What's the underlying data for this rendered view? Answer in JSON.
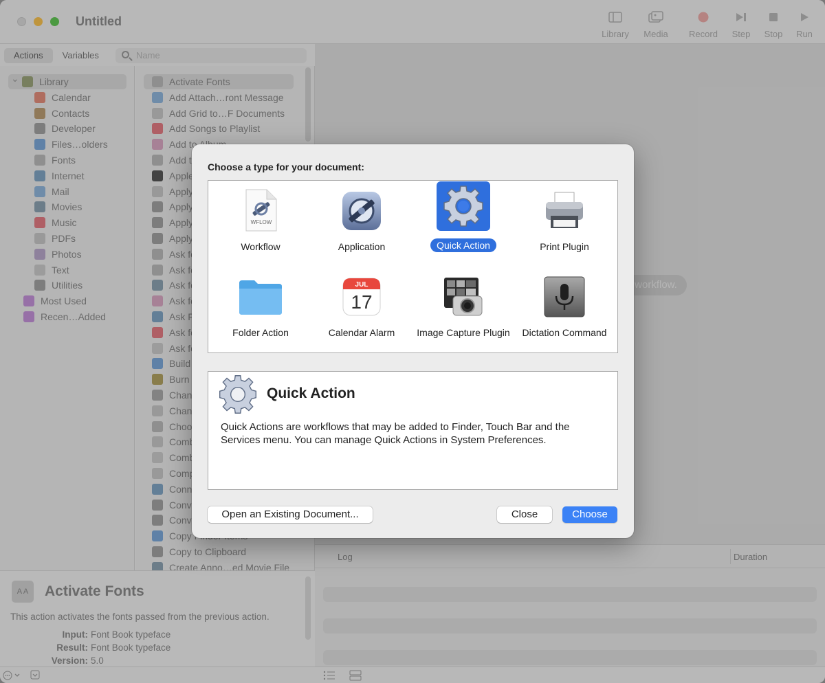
{
  "window": {
    "title": "Untitled"
  },
  "toolbar": {
    "library": "Library",
    "media": "Media",
    "record": "Record",
    "step": "Step",
    "stop": "Stop",
    "run": "Run"
  },
  "sidebar": {
    "tabs": {
      "actions": "Actions",
      "variables": "Variables"
    },
    "search_placeholder": "Name",
    "library": [
      {
        "label": "Library",
        "icon": "library-icon",
        "color": "#9aa37a"
      },
      {
        "label": "Calendar",
        "icon": "calendar-icon",
        "color": "#e08c7a"
      },
      {
        "label": "Contacts",
        "icon": "contacts-icon",
        "color": "#b99b73"
      },
      {
        "label": "Developer",
        "icon": "tools-icon",
        "color": "#a0a0a0"
      },
      {
        "label": "Files…olders",
        "icon": "finder-icon",
        "color": "#7aa6d6"
      },
      {
        "label": "Fonts",
        "icon": "fonts-icon",
        "color": "#b8b8b8"
      },
      {
        "label": "Internet",
        "icon": "globe-icon",
        "color": "#7fa3c2"
      },
      {
        "label": "Mail",
        "icon": "mail-icon",
        "color": "#8fb4d9"
      },
      {
        "label": "Movies",
        "icon": "movies-icon",
        "color": "#8ba0b0"
      },
      {
        "label": "Music",
        "icon": "music-icon",
        "color": "#e07a82"
      },
      {
        "label": "PDFs",
        "icon": "pdf-icon",
        "color": "#c4c4c4"
      },
      {
        "label": "Photos",
        "icon": "photos-icon",
        "color": "#b7a6c8"
      },
      {
        "label": "Text",
        "icon": "text-icon",
        "color": "#c8c8c8"
      },
      {
        "label": "Utilities",
        "icon": "tools-icon",
        "color": "#a0a0a0"
      },
      {
        "label": "Most Used",
        "icon": "smart-folder-icon",
        "color": "#c290d6"
      },
      {
        "label": "Recen…Added",
        "icon": "smart-folder-icon",
        "color": "#c290d6"
      }
    ],
    "actions": [
      {
        "label": "Activate Fonts",
        "color": "#b8b8b8"
      },
      {
        "label": "Add Attach…ront Message",
        "color": "#8fb4d9"
      },
      {
        "label": "Add Grid to…F Documents",
        "color": "#c4c4c4"
      },
      {
        "label": "Add Songs to Playlist",
        "color": "#e07a82"
      },
      {
        "label": "Add to Album",
        "color": "#d6a6c0"
      },
      {
        "label": "Add t",
        "color": "#b8b8b8"
      },
      {
        "label": "Apple",
        "color": "#555555"
      },
      {
        "label": "Apply",
        "color": "#c4c4c4"
      },
      {
        "label": "Apply",
        "color": "#a0a0a0"
      },
      {
        "label": "Apply",
        "color": "#a0a0a0"
      },
      {
        "label": "Apply",
        "color": "#a0a0a0"
      },
      {
        "label": "Ask fo",
        "color": "#b8b8b8"
      },
      {
        "label": "Ask fo",
        "color": "#b8b8b8"
      },
      {
        "label": "Ask fo",
        "color": "#8ba0b0"
      },
      {
        "label": "Ask fo",
        "color": "#d6a6c0"
      },
      {
        "label": "Ask F",
        "color": "#7fa3c2"
      },
      {
        "label": "Ask fo",
        "color": "#e07a82"
      },
      {
        "label": "Ask fo",
        "color": "#c8c8c8"
      },
      {
        "label": "Build",
        "color": "#7aa6d6"
      },
      {
        "label": "Burn",
        "color": "#b0a060"
      },
      {
        "label": "Chan",
        "color": "#a8a8a8"
      },
      {
        "label": "Chan",
        "color": "#c4c4c4"
      },
      {
        "label": "Choo",
        "color": "#b8b8b8"
      },
      {
        "label": "Comb",
        "color": "#c4c4c4"
      },
      {
        "label": "Comb",
        "color": "#c8c8c8"
      },
      {
        "label": "Comp",
        "color": "#c4c4c4"
      },
      {
        "label": "Conn",
        "color": "#7fa3c2"
      },
      {
        "label": "Conve",
        "color": "#a0a0a0"
      },
      {
        "label": "Conve",
        "color": "#a0a0a0"
      },
      {
        "label": "Copy Finder Items",
        "color": "#7aa6d6"
      },
      {
        "label": "Copy to Clipboard",
        "color": "#a0a0a0"
      },
      {
        "label": "Create Anno…ed Movie File",
        "color": "#8ba0b0"
      }
    ]
  },
  "info": {
    "name": "Activate Fonts",
    "icon_text": "A A",
    "description": "This action activates the fonts passed from the previous action.",
    "input_label": "Input:",
    "input_value": "Font Book typeface",
    "result_label": "Result:",
    "result_value": "Font Book typeface",
    "version_label": "Version:",
    "version_value": "5.0"
  },
  "canvas": {
    "hint": "r workflow."
  },
  "log": {
    "col_log": "Log",
    "col_duration": "Duration"
  },
  "dialog": {
    "title": "Choose a type for your document:",
    "types": [
      {
        "label": "Workflow",
        "icon": "workflow-file-icon",
        "sublabel": "WFLOW"
      },
      {
        "label": "Application",
        "icon": "automator-app-icon"
      },
      {
        "label": "Quick Action",
        "icon": "gear-icon",
        "selected": true
      },
      {
        "label": "Print Plugin",
        "icon": "printer-icon"
      },
      {
        "label": "Folder Action",
        "icon": "folder-icon"
      },
      {
        "label": "Calendar Alarm",
        "icon": "calendar-icon",
        "month": "JUL",
        "day": "17"
      },
      {
        "label": "Image Capture Plugin",
        "icon": "image-capture-icon"
      },
      {
        "label": "Dictation Command",
        "icon": "microphone-icon"
      }
    ],
    "detail": {
      "name": "Quick Action",
      "text": "Quick Actions are workflows that may be added to Finder, Touch Bar and the Services menu. You can manage Quick Actions in System Preferences."
    },
    "buttons": {
      "open_existing": "Open an Existing Document...",
      "close": "Close",
      "choose": "Choose"
    },
    "accent": "#2f6fdd"
  }
}
